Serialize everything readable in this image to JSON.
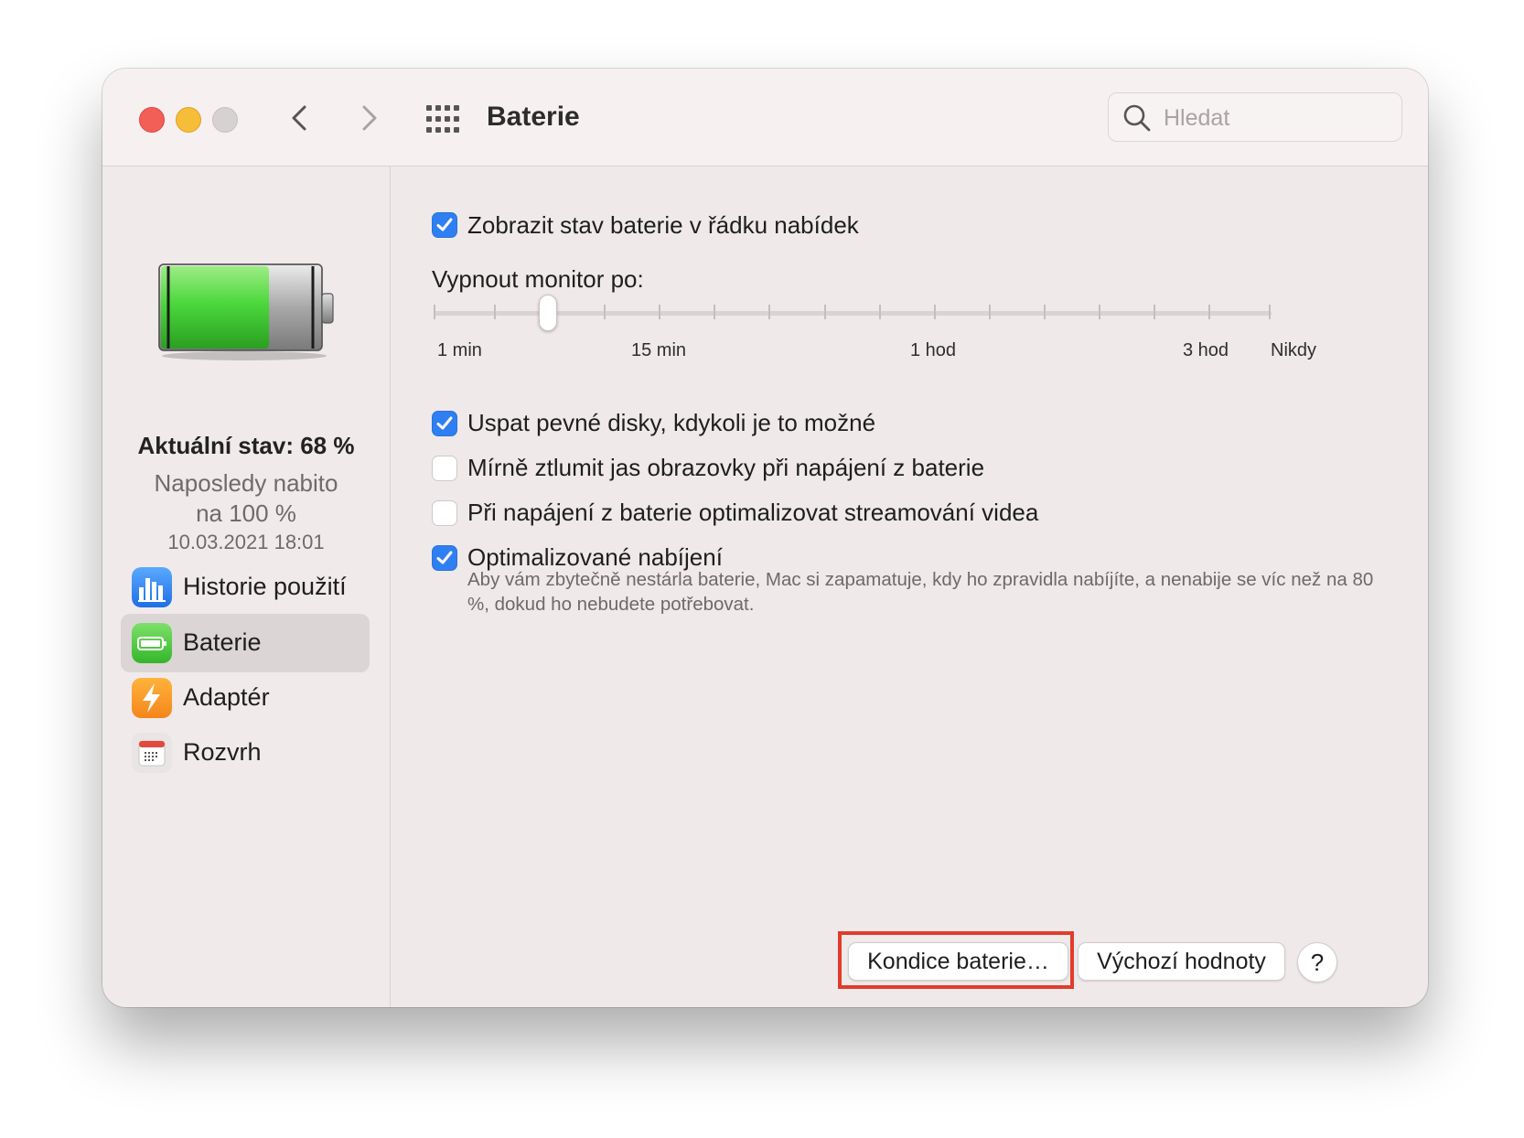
{
  "window": {
    "title": "Baterie",
    "search_placeholder": "Hledat"
  },
  "sidebar": {
    "battery_level": 0.68,
    "status_main": "Aktuální stav: 68 %",
    "status_line1": "Naposledy nabito",
    "status_line2": "na 100 %",
    "status_date": "10.03.2021 18:01",
    "items": [
      {
        "label": "Historie použití",
        "icon": "chart-icon",
        "selected": false
      },
      {
        "label": "Baterie",
        "icon": "battery-icon",
        "selected": true
      },
      {
        "label": "Adaptér",
        "icon": "bolt-icon",
        "selected": false
      },
      {
        "label": "Rozvrh",
        "icon": "calendar-icon",
        "selected": false
      }
    ]
  },
  "options": {
    "show_status": {
      "label": "Zobrazit stav baterie v řádku nabídek",
      "checked": true
    },
    "sleep_disks": {
      "label": "Uspat pevné disky, kdykoli je to možné",
      "checked": true
    },
    "dim_display": {
      "label": "Mírně ztlumit jas obrazovky při napájení z baterie",
      "checked": false
    },
    "optimize_video": {
      "label": "Při napájení z baterie optimalizovat streamování videa",
      "checked": false
    },
    "optimized_charging": {
      "label": "Optimalizované nabíjení",
      "checked": true,
      "description": "Aby vám zbytečně nestárla baterie, Mac si zapamatuje, kdy ho zpravidla nabíjíte, a nenabije se víc než na 80 %, dokud ho nebudete potřebovat."
    }
  },
  "display_sleep": {
    "title": "Vypnout monitor po:",
    "tick_labels": [
      "1 min",
      "15 min",
      "1 hod",
      "3 hod",
      "Nikdy"
    ],
    "value_label": "15 min"
  },
  "buttons": {
    "battery_health": "Kondice baterie…",
    "defaults": "Výchozí hodnoty",
    "help": "?"
  },
  "colors": {
    "accent": "#2f7ff3",
    "highlight": "#e23b2c",
    "battery_green": "#46d640"
  }
}
